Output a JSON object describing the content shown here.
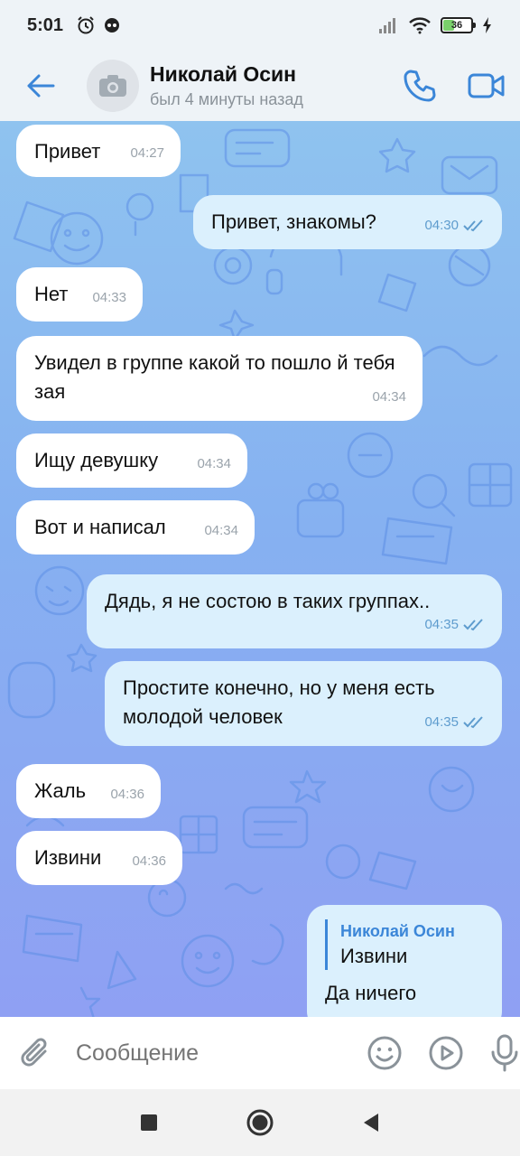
{
  "status_bar": {
    "time": "5:01",
    "battery_level": "36"
  },
  "header": {
    "contact_name": "Николай Осин",
    "contact_status": "был 4 минуты назад"
  },
  "messages": [
    {
      "text": "Привет",
      "time": "04:27",
      "direction": "in"
    },
    {
      "text": "Привет, знакомы?",
      "time": "04:30",
      "direction": "out"
    },
    {
      "text": "Нет",
      "time": "04:33",
      "direction": "in"
    },
    {
      "text": "Увидел в группе какой то пошло й тебя зая",
      "time": "04:34",
      "direction": "in"
    },
    {
      "text": "Ищу девушку",
      "time": "04:34",
      "direction": "in"
    },
    {
      "text": "Вот и написал",
      "time": "04:34",
      "direction": "in"
    },
    {
      "text": "Дядь, я не состою в таких группах..",
      "time": "04:35",
      "direction": "out"
    },
    {
      "text": "Простите конечно, но у меня есть молодой человек",
      "time": "04:35",
      "direction": "out"
    },
    {
      "text": "Жаль",
      "time": "04:36",
      "direction": "in"
    },
    {
      "text": "Извини",
      "time": "04:36",
      "direction": "in"
    },
    {
      "reply_author": "Николай Осин",
      "reply_text": "Извини",
      "text": "Да ничего",
      "direction": "out"
    }
  ],
  "composer": {
    "placeholder": "Сообщение"
  },
  "colors": {
    "accent": "#3b86d8",
    "incoming_bubble": "#ffffff",
    "outgoing_bubble": "#dbf0fd",
    "chat_bg_top": "#8fc3ef",
    "chat_bg_bottom": "#8fa0f3"
  },
  "icons": {
    "back": "arrow-left-icon",
    "call": "phone-icon",
    "video": "video-camera-icon",
    "attach": "paperclip-icon",
    "emoji": "smiley-icon",
    "video_message": "play-circle-icon",
    "voice": "microphone-icon"
  }
}
